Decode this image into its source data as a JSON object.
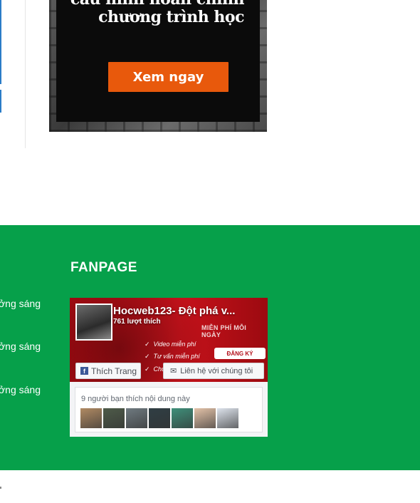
{
  "promo": {
    "line1": "cấu hình hoàn chỉnh",
    "line2": "chương trình học",
    "cta_label": "Xem ngay"
  },
  "footer": {
    "links": [
      "ởng sáng",
      "ởng sáng",
      "ởng sáng"
    ],
    "fanpage_title": "FANPAGE"
  },
  "facebook_widget": {
    "page_name": "Hocweb123- Đột phá v...",
    "likes": "761 lượt thích",
    "slogan": "MIỄN PHÍ MỖI NGÀY",
    "features": [
      "Video miễn phí",
      "Tư vấn miễn phí",
      "Chứ..."
    ],
    "register_label": "ĐĂNG KÝ",
    "like_button_label": "Thích Trang",
    "contact_button_label": "Liên hệ với chúng tôi",
    "friends_text": "9 người bạn thích nội dung này",
    "friend_avatar_colors": [
      "#b08a63",
      "#4e5b49",
      "#6f7a80",
      "#2f3e44",
      "#3f8f7a",
      "#e3c2a8",
      "#dde3ec"
    ]
  },
  "colors": {
    "footer_green": "#06a04a",
    "cta_orange": "#e8590c",
    "fb_red": "#c7121b"
  }
}
